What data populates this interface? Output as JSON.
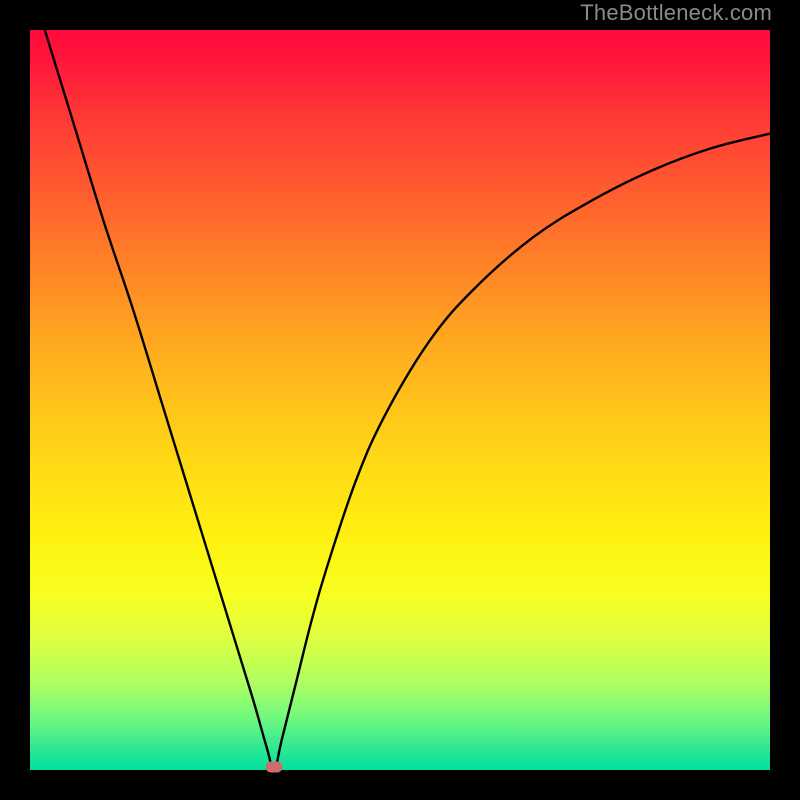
{
  "watermark": "TheBottleneck.com",
  "chart_data": {
    "type": "line",
    "title": "",
    "xlabel": "",
    "ylabel": "",
    "xlim": [
      0,
      100
    ],
    "ylim": [
      0,
      100
    ],
    "minimum_point": {
      "x": 33,
      "y": 0
    },
    "series": [
      {
        "name": "curve",
        "x": [
          2,
          6,
          10,
          14,
          18,
          22,
          26,
          30,
          32,
          33,
          34,
          36,
          38,
          40,
          44,
          48,
          54,
          60,
          68,
          76,
          84,
          92,
          100
        ],
        "y": [
          100,
          87,
          74,
          62,
          49,
          36,
          23,
          10,
          3,
          0,
          4,
          12,
          20,
          27,
          39,
          48,
          58,
          65,
          72,
          77,
          81,
          84,
          86
        ]
      }
    ]
  },
  "colors": {
    "curve": "#000000",
    "minpoint": "#cf6b6b",
    "frame": "#000000"
  }
}
